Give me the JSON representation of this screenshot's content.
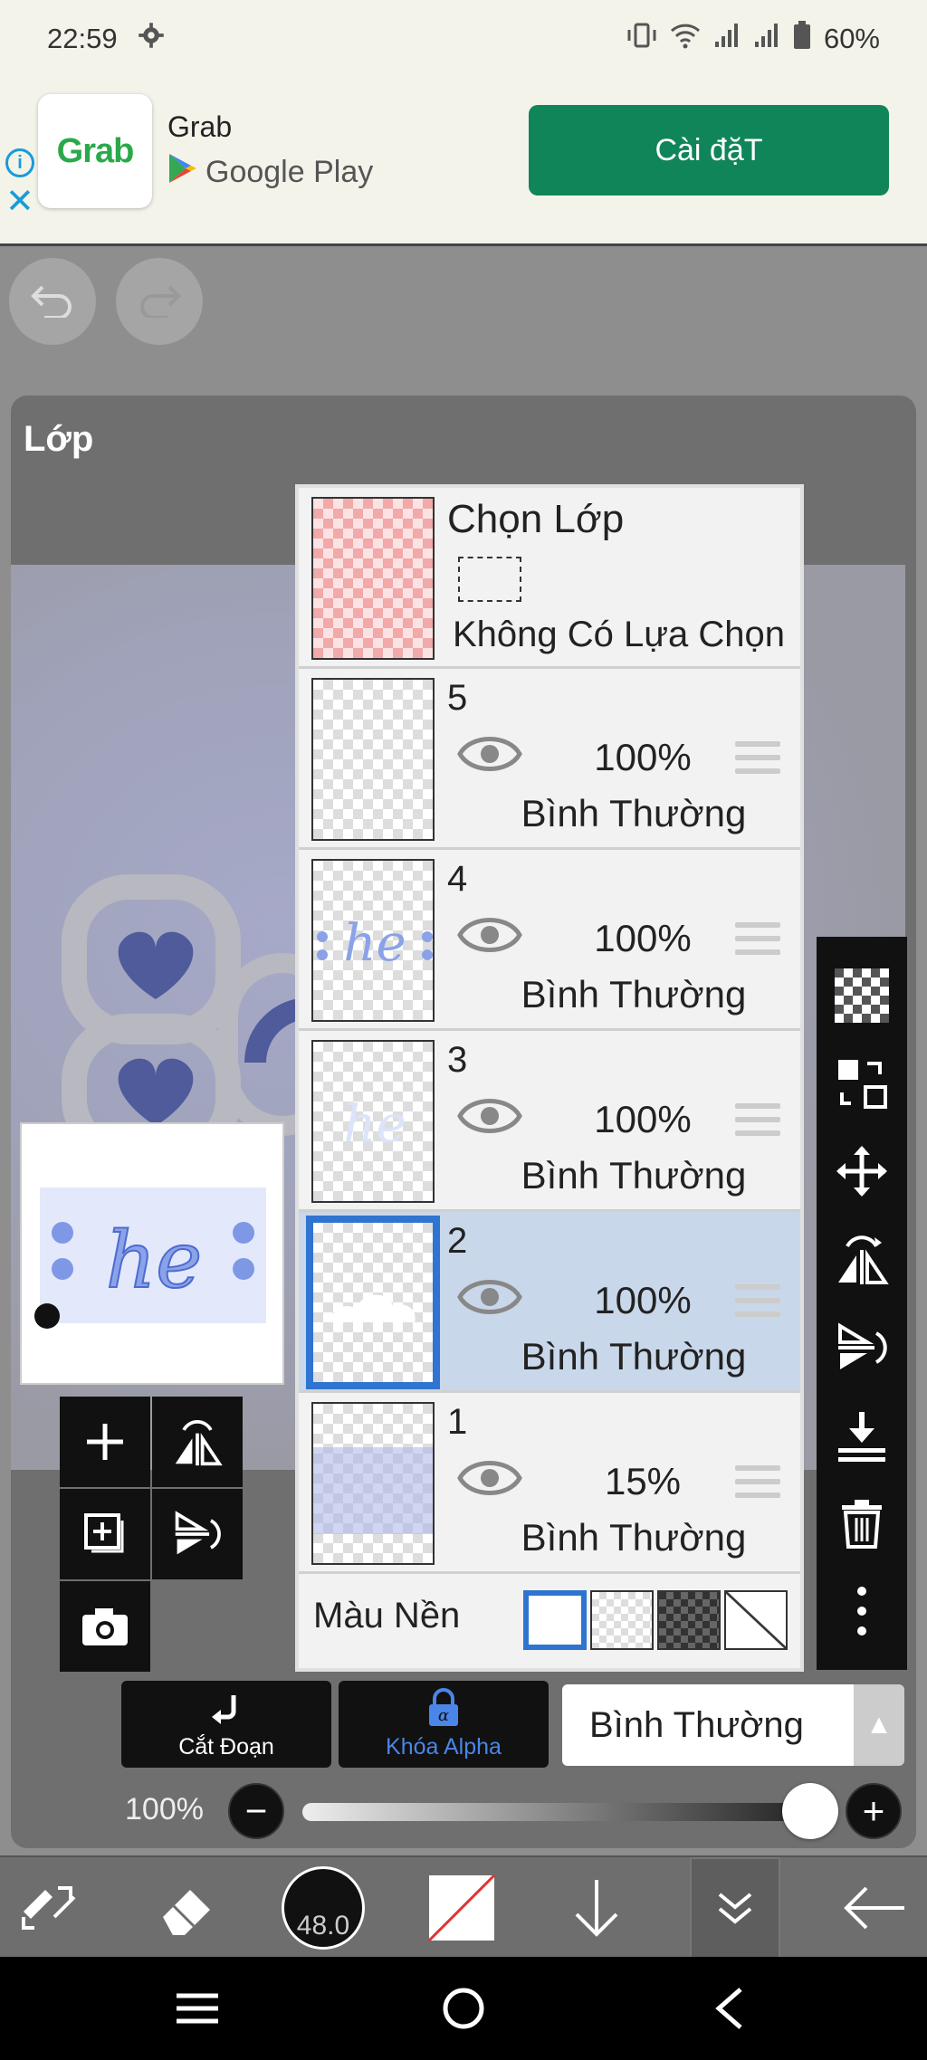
{
  "status_bar": {
    "time": "22:59",
    "battery": "60%"
  },
  "ad": {
    "logo_text": "Grab",
    "app_name": "Grab",
    "store": "Google Play",
    "install_label": "Cài đặT"
  },
  "panel": {
    "title": "Lớp",
    "selection": {
      "title": "Chọn Lớp",
      "subtitle": "Không Có Lựa Chọn"
    },
    "layers": [
      {
        "num": "5",
        "opacity": "100%",
        "blend": "Bình Thường",
        "selected": false
      },
      {
        "num": "4",
        "opacity": "100%",
        "blend": "Bình Thường",
        "selected": false
      },
      {
        "num": "3",
        "opacity": "100%",
        "blend": "Bình Thường",
        "selected": false
      },
      {
        "num": "2",
        "opacity": "100%",
        "blend": "Bình Thường",
        "selected": true
      },
      {
        "num": "1",
        "opacity": "15%",
        "blend": "Bình Thường",
        "selected": false
      }
    ],
    "background_label": "Màu Nền",
    "clip_label": "Cắt Đoạn",
    "alpha_lock_label": "Khóa Alpha",
    "blend_mode_value": "Bình Thường",
    "opacity_value": "100%",
    "opacity_level": 1.0
  },
  "toolbar": {
    "brush_size": "48.0"
  },
  "icons": {
    "right_tools": [
      "checker-icon",
      "transform-icon",
      "move-icon",
      "flip-horizontal-icon",
      "flip-vertical-icon",
      "merge-down-icon",
      "trash-icon",
      "more-icon"
    ],
    "left_tools": [
      "add-layer-icon",
      "flip-layer-h-icon",
      "add-copy-icon",
      "flip-layer-v-icon",
      "camera-icon"
    ]
  },
  "colors": {
    "accent": "#2f74d0",
    "install_button": "#10855a",
    "selected_row": "#c9d7ea"
  }
}
